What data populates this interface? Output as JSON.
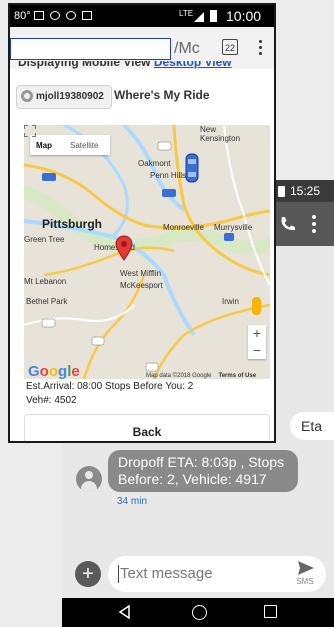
{
  "front_phone": {
    "status_bar": {
      "temperature": "80°",
      "network": "LTE",
      "time": "10:00"
    },
    "url_bar": {
      "suffix": "/Mc",
      "tab_count": "22"
    },
    "mobile_view_text": "Displaying Mobile View",
    "desktop_view_link": "Desktop View",
    "user_chip": "mjoll19380902",
    "page_heading": "Where's My Ride",
    "map": {
      "tab_map": "Map",
      "tab_satellite": "Satellite",
      "labels": {
        "new_kensington": "New\nKensington",
        "oakmont": "Oakmont",
        "penn_hills": "Penn Hills",
        "pittsburgh": "Pittsburgh",
        "monroeville": "Monroeville",
        "murrysville": "Murrysville",
        "green_tree": "Green Tree",
        "homestead": "Homestead",
        "west_mifflin": "West Mifflin",
        "mckeesport": "McKeesport",
        "mt_lebanon": "Mt Lebanon",
        "bethel_park": "Bethel Park",
        "irwin": "Irwin"
      },
      "route_shields": [
        "28",
        "279",
        "376",
        "76",
        "22",
        "88",
        "43",
        "51",
        "30"
      ],
      "google_logo": "Google",
      "credit": "Map data ©2018 Google",
      "terms": "Terms of Use",
      "zoom_in": "+",
      "zoom_out": "−"
    },
    "arrival_line": "Est.Arrival: 08:00  Stops Before You: 2",
    "vehicle_line": "Veh#: 4502",
    "back_button": "Back"
  },
  "back_phone": {
    "status_time": "15:25",
    "incoming_bubble": "Eta",
    "message_bubble": "Dropoff ETA:  8:03p  , Stops Before: 2, Vehicle: 4917",
    "message_time": "34 min",
    "input_placeholder": "Text message",
    "send_label": "SMS",
    "add_label": "+"
  },
  "colors": {
    "link": "#1a56c8",
    "url_border": "#1e40c0",
    "map_land": "#e7e3d9",
    "highway": "#f9c846",
    "pin": "#e53935",
    "vehicle": "#3a6ed4"
  }
}
